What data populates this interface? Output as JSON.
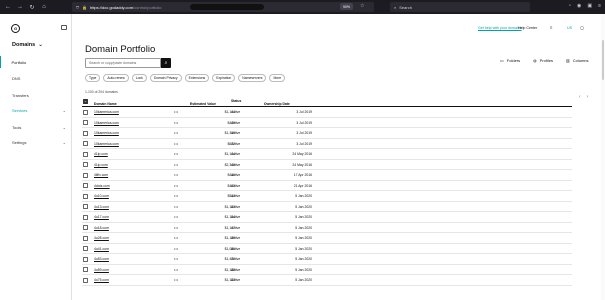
{
  "browser": {
    "url_host": "https://dcc.godaddy.com",
    "url_path": "/control/portfolio",
    "zoom": "90%",
    "search_placeholder": "Search"
  },
  "sidebar": {
    "logo_glyph": "G",
    "section_title": "Domains",
    "items": [
      {
        "label": "Portfolio"
      },
      {
        "label": "DNS"
      },
      {
        "label": "Transfers"
      },
      {
        "label": "Services"
      },
      {
        "label": "Tools"
      },
      {
        "label": "Settings"
      }
    ]
  },
  "header": {
    "buy_link": "Get help with your domains",
    "help_center": "Help Center",
    "flag": "US"
  },
  "page": {
    "title": "Domain Portfolio",
    "search_placeholder": "Search or copy/paste domains",
    "tools": {
      "folders": "Folders",
      "profiles": "Profiles",
      "columns": "Columns"
    },
    "filters": [
      "Type",
      "Auto-renew",
      "Lock",
      "Domain Privacy",
      "Extensions",
      "Expiration",
      "Nameservers",
      "More"
    ],
    "count_text": "1-100 of 204 domains"
  },
  "table": {
    "headers": {
      "domain": "Domain Name",
      "value": "Estimated Value",
      "status": "Status",
      "date": "Ownership Date"
    },
    "rows": [
      {
        "domain": "10kamerica.com",
        "value": "$1,144",
        "status": "Active",
        "date": "3 Jul 2019"
      },
      {
        "domain": "10kamerica.com",
        "value": "$449",
        "status": "Active",
        "date": "3 Jul 2019"
      },
      {
        "domain": "10kamerica.com",
        "value": "$1,319",
        "status": "Active",
        "date": "3 Jul 2019"
      },
      {
        "domain": "10kamerica.com",
        "value": "$672",
        "status": "Active",
        "date": "3 Jul 2019"
      },
      {
        "domain": "41ip.com",
        "value": "$1,144",
        "status": "Active",
        "date": "24 May 2016"
      },
      {
        "domain": "41ip.com",
        "value": "$2,348",
        "status": "Active",
        "date": "24 May 2016"
      },
      {
        "domain": "4ilfix.com",
        "value": "$416",
        "status": "Active",
        "date": "17 Apr 2016"
      },
      {
        "domain": "4dots.com",
        "value": "$403",
        "status": "Active",
        "date": "21 Apr 2016"
      },
      {
        "domain": "4u10.com",
        "value": "$513",
        "status": "Active",
        "date": "5 Jan 2020"
      },
      {
        "domain": "4u13.com",
        "value": "$1,153",
        "status": "Active",
        "date": "5 Jan 2020"
      },
      {
        "domain": "4u17.com",
        "value": "$1,154",
        "status": "Active",
        "date": "5 Jan 2020"
      },
      {
        "domain": "4u18.com",
        "value": "$1,147",
        "status": "Active",
        "date": "5 Jan 2020"
      },
      {
        "domain": "4u28.com",
        "value": "$1,139",
        "status": "Active",
        "date": "5 Jan 2020"
      },
      {
        "domain": "4u41.com",
        "value": "$1,086",
        "status": "Active",
        "date": "5 Jan 2020"
      },
      {
        "domain": "4u53.com",
        "value": "$1,470",
        "status": "Active",
        "date": "5 Jan 2020"
      },
      {
        "domain": "4u59.com",
        "value": "$1,188",
        "status": "Active",
        "date": "5 Jan 2020"
      },
      {
        "domain": "4u75.com",
        "value": "$1,153",
        "status": "Active",
        "date": "5 Jan 2020"
      }
    ]
  }
}
